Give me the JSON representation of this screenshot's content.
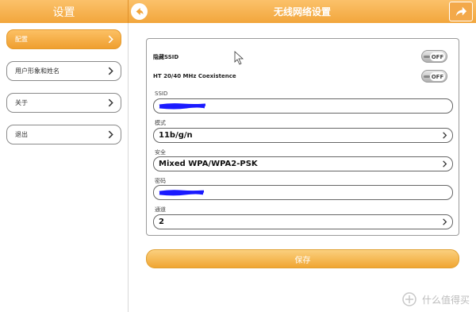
{
  "header": {
    "left_title": "设置",
    "title": "无线网络设置"
  },
  "sidebar": {
    "items": [
      {
        "label": "配置",
        "active": true
      },
      {
        "label": "用户形象和姓名",
        "active": false
      },
      {
        "label": "关于",
        "active": false
      },
      {
        "label": "退出",
        "active": false
      }
    ]
  },
  "form": {
    "hide_ssid": {
      "label": "隐藏SSID",
      "state": "OFF"
    },
    "ht_coexistence": {
      "label": "HT 20/40 MHz Coexistence",
      "state": "OFF"
    },
    "ssid": {
      "label": "SSID",
      "value": ""
    },
    "mode": {
      "label": "模式",
      "value": "11b/g/n"
    },
    "security": {
      "label": "安全",
      "value": "Mixed WPA/WPA2-PSK"
    },
    "password": {
      "label": "密码",
      "value": ""
    },
    "channel": {
      "label": "通道",
      "value": "2"
    }
  },
  "save_label": "保存",
  "watermark": {
    "text": "什么值得买"
  },
  "colors": {
    "accent": "#f2a63c",
    "redaction": "#1a1aff"
  }
}
